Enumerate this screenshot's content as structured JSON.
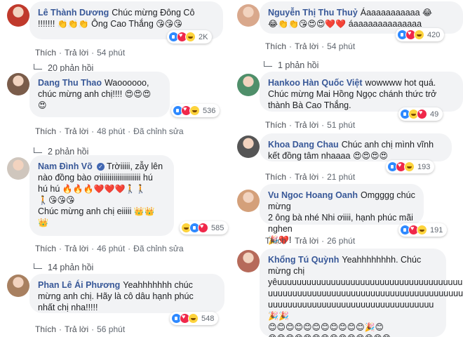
{
  "labels": {
    "like": "Thích",
    "reply": "Trả lời",
    "edited": "Đã chỉnh sửa"
  },
  "left": [
    {
      "author": "Lê Thành Dương",
      "verified": false,
      "lines": [
        [
          {
            "t": "Chúc mừng Đông Cô"
          }
        ],
        [
          {
            "t": "!!!!!!! "
          },
          {
            "e": "👏👏👏"
          },
          {
            "t": " Ông Cao Thắng "
          },
          {
            "e": "😘😘😘"
          }
        ]
      ],
      "time": "54 phút",
      "edited": false,
      "reactions": [
        "like",
        "love",
        "haha"
      ],
      "reaction_count": "2K",
      "replies": "20 phản hồi"
    },
    {
      "author": "Dang Thu Thao",
      "verified": false,
      "lines": [
        [
          {
            "t": "Waoooooo,"
          }
        ],
        [
          {
            "t": "chúc mừng anh chị!!!! "
          },
          {
            "e": "😍😍😍"
          }
        ],
        [
          {
            "e": "😍"
          }
        ]
      ],
      "time": "48 phút",
      "edited": true,
      "reactions": [
        "like",
        "love",
        "haha"
      ],
      "reaction_count": "536",
      "replies": "2 phản hồi"
    },
    {
      "author": "Nam Đình Võ",
      "verified": true,
      "lines": [
        [
          {
            "t": "Trờiiiii, zẫy lên"
          }
        ],
        [
          {
            "t": "nào đồng bào ơiiiiiiiiiiiiiiiiiiiii hú"
          }
        ],
        [
          {
            "t": "hú hú "
          },
          {
            "e": "🔥🔥🔥❤️❤️❤️🚶🚶"
          }
        ],
        [
          {
            "e": "🚶😘😘😘"
          }
        ],
        [
          {
            "t": "Chúc mừng anh chị eiiiii "
          },
          {
            "e": "👑👑"
          }
        ],
        [
          {
            "e": "👑"
          }
        ]
      ],
      "time": "46 phút",
      "edited": true,
      "reactions": [
        "haha",
        "like",
        "love"
      ],
      "reaction_count": "585",
      "replies": "14 phản hồi"
    },
    {
      "author": "Phan Lê Ái Phương",
      "verified": false,
      "lines": [
        [
          {
            "t": "Yeahhhhhhh chúc"
          }
        ],
        [
          {
            "t": "mừng anh chị. Hãy là cô dâu hạnh phúc"
          }
        ],
        [
          {
            "t": "nhất chị nha!!!!!"
          }
        ]
      ],
      "time": "56 phút",
      "edited": false,
      "reactions": [
        "like",
        "love",
        "haha"
      ],
      "reaction_count": "548",
      "replies": ""
    }
  ],
  "right": [
    {
      "author": "Nguyễn Thị Thu Thuỷ",
      "verified": false,
      "lines": [
        [
          {
            "t": "Áaaaaaaaaaaa "
          },
          {
            "e": "😂"
          }
        ],
        [
          {
            "e": "😂👏👏😘😍😍❤️❤️"
          },
          {
            "t": " áaaaaaaaaaaaaaa"
          }
        ]
      ],
      "time": "54 phút",
      "edited": false,
      "reactions": [
        "like",
        "love",
        "haha"
      ],
      "reaction_count": "420",
      "replies": "1 phản hồi"
    },
    {
      "author": "Hankoo Hàn Quốc Việt",
      "verified": false,
      "lines": [
        [
          {
            "t": "wowwww hot quá."
          }
        ],
        [
          {
            "t": "Chúc mừng Mai Hồng Ngọc chánh thức trở"
          }
        ],
        [
          {
            "t": "thành Bà Cao Thắng."
          }
        ]
      ],
      "time": "51 phút",
      "edited": false,
      "reactions": [
        "like",
        "haha",
        "love"
      ],
      "reaction_count": "49",
      "replies": ""
    },
    {
      "author": "Khoa Dang Chau",
      "verified": false,
      "lines": [
        [
          {
            "t": "Chúc anh chị mình vĩnh"
          }
        ],
        [
          {
            "t": "kết đồng tâm nhaaaa "
          },
          {
            "e": "😍😍😍😍"
          }
        ]
      ],
      "time": "21 phút",
      "edited": false,
      "reactions": [
        "like",
        "love",
        "haha"
      ],
      "reaction_count": "193",
      "replies": ""
    },
    {
      "author": "Vu Ngoc Hoang Oanh",
      "verified": false,
      "lines": [
        [
          {
            "t": "Omgggg chúc mừng"
          }
        ],
        [
          {
            "t": "2 ông bà nhé Nhi ơiiii, hạnh phúc mãi nghen"
          }
        ],
        [
          {
            "e": "🎉❤️"
          },
          {
            "t": "!"
          }
        ]
      ],
      "time": "26 phút",
      "edited": false,
      "reactions": [
        "like",
        "love",
        "haha"
      ],
      "reaction_count": "191",
      "replies": ""
    },
    {
      "author": "Khổng Tú Quỳnh",
      "verified": false,
      "lines": [
        [
          {
            "t": "Yeahhhhhhhh. Chúc"
          }
        ],
        [
          {
            "t": "mừng chị"
          }
        ],
        [
          {
            "t": "yêuuuuuuuuuuuuuuuuuuuuuuuuuuuuuuuuuuuuuu"
          }
        ],
        [
          {
            "t": "uuuuuuuuuuuuuuuuuuuuuuuuuuuuuuuuuuuuuuuuu"
          }
        ],
        [
          {
            "t": "uuuuuuuuuuuuuuuuuuuuuuuuuuuuuuuuuu "
          },
          {
            "e": "🎉🎉"
          }
        ],
        [
          {
            "e": "😊😊😊😊😊😊😊😊😊😊😊🎉😊"
          }
        ],
        [
          {
            "e": "😊😊😊😊😊😊😊😊😊😊😊😊😊😊"
          }
        ]
      ],
      "time": "",
      "edited": false,
      "reactions": [],
      "reaction_count": "",
      "replies": ""
    }
  ]
}
